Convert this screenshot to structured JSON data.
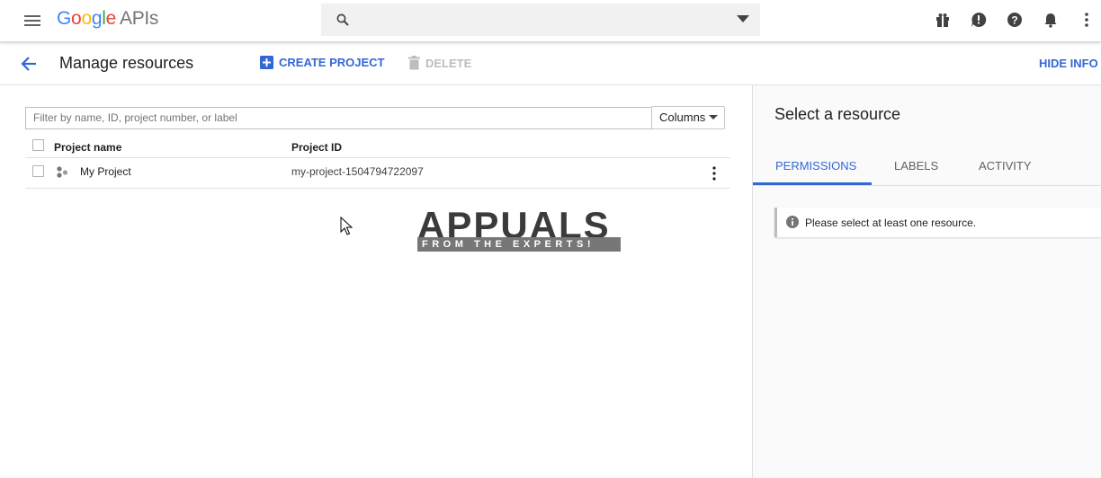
{
  "header": {
    "logo_google": "Google",
    "logo_apis": "APIs",
    "search_placeholder": "",
    "icons": [
      "menu-icon",
      "search-icon",
      "gift-icon",
      "feedback-icon",
      "help-icon",
      "notifications-icon",
      "more-vert-icon"
    ]
  },
  "toolbar": {
    "title": "Manage resources",
    "create_label": "CREATE PROJECT",
    "delete_label": "DELETE",
    "hide_info_label": "HIDE INFO P"
  },
  "resources": {
    "filter_placeholder": "Filter by name, ID, project number, or label",
    "columns_label": "Columns",
    "headers": {
      "name": "Project name",
      "id": "Project ID"
    },
    "rows": [
      {
        "name": "My Project",
        "id": "my-project-1504794722097"
      }
    ]
  },
  "info_panel": {
    "title": "Select a resource",
    "tabs": [
      "PERMISSIONS",
      "LABELS",
      "ACTIVITY"
    ],
    "active_tab": "PERMISSIONS",
    "message": "Please select at least one resource."
  },
  "watermark": {
    "text": "APPUALS",
    "tagline": "FROM THE EXPERTS!"
  },
  "colors": {
    "accent": "#3367d6",
    "disabled": "#bdbdbd",
    "panel_bg": "#fafafa"
  }
}
